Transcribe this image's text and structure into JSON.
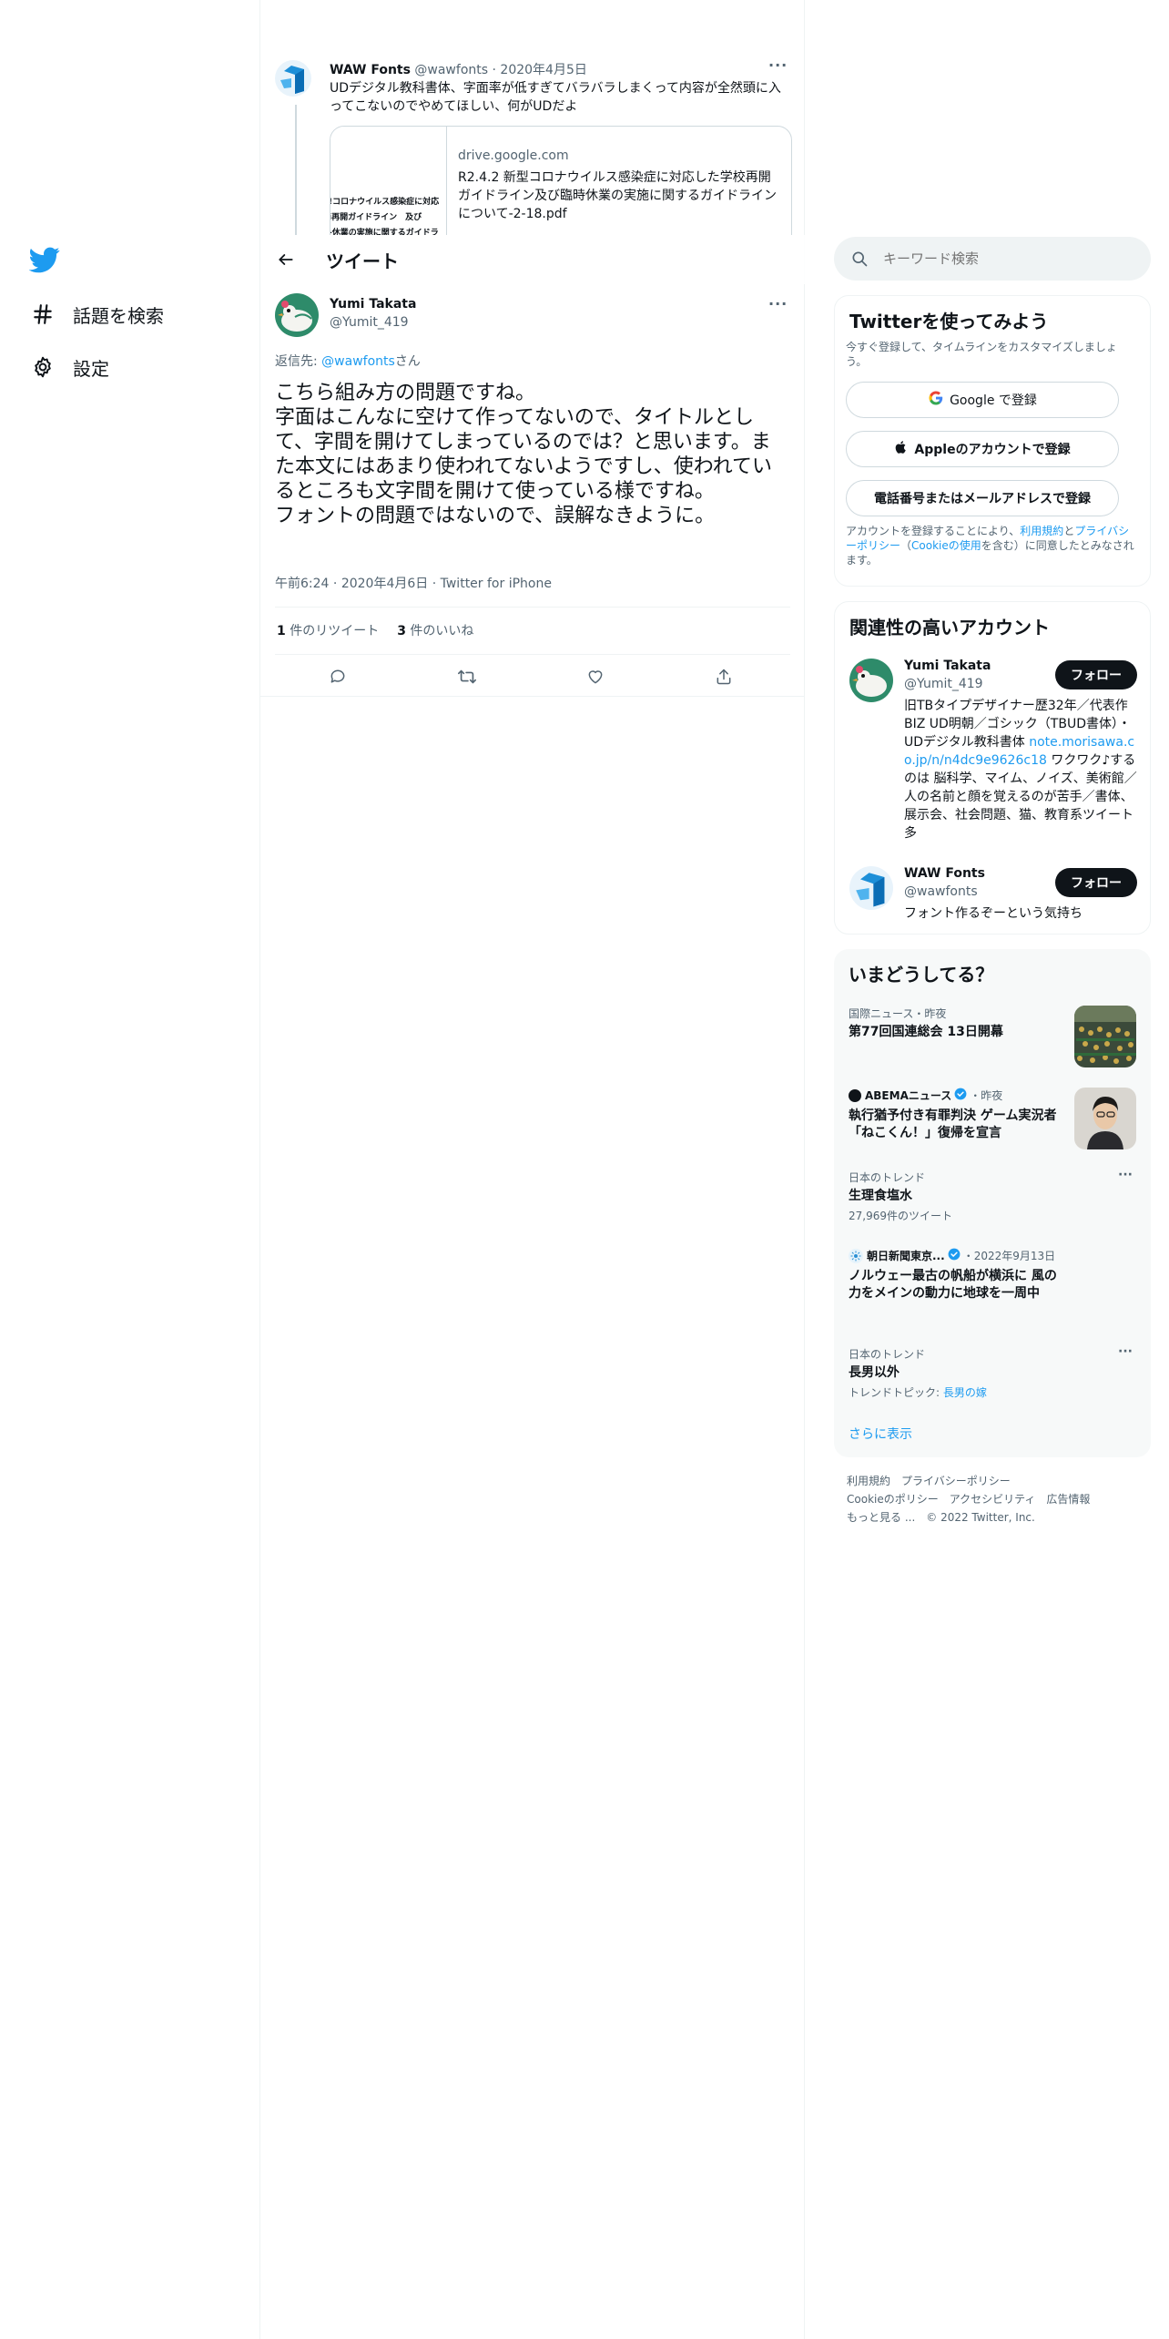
{
  "nav": {
    "explore_label": "話題を検索",
    "settings_label": "設定"
  },
  "prev_tweet": {
    "name": "WAW Fonts",
    "handle": "@wawfonts",
    "date": "2020年4月5日",
    "text": "UDデジタル教科書体、字面率が低すぎてバラバラしまくって内容が全然頭に入ってこないのでやめてほしい、何がUDだよ",
    "card": {
      "thumb_lines": [
        "!コロナウイルス感染症に対応",
        "i再開ガイドライン　及び",
        "-休業の実施に関するガイドラ"
      ],
      "domain": "drive.google.com",
      "title": "R2.4.2 新型コロナウイルス感染症に対応した学校再開ガイドライン及び臨時休業の実施に関するガイドラインについて-2-18.pdf"
    }
  },
  "header": {
    "title": "ツイート"
  },
  "tweet": {
    "name": "Yumi Takata",
    "handle": "@Yumit_419",
    "reply_prefix": "返信先: ",
    "reply_handle": "@wawfonts",
    "reply_suffix": "さん",
    "lines": [
      "こちら組み方の問題ですね。",
      "字面はこんなに空けて作ってないので、タイトルとして、字間を開けてしまっているのでは？と思います。また本文にはあまり使われてないようですし、使われているところも文字間を開けて使っている様ですね。",
      "フォントの問題ではないので、誤解なきように。"
    ],
    "time": "午前6:24",
    "date": "2020年4月6日",
    "source": "Twitter for iPhone",
    "retweets_count": "1",
    "retweets_label": " 件のリツイート",
    "likes_count": "3",
    "likes_label": " 件のいいね"
  },
  "search": {
    "placeholder": "キーワード検索"
  },
  "signup": {
    "title": "Twitterを使ってみよう",
    "subtitle": "今すぐ登録して、タイムラインをカスタマイズしましょう。",
    "google_label": "Google で登録",
    "apple_label": "Appleのアカウントで登録",
    "phone_label": "電話番号またはメールアドレスで登録",
    "legal_prefix": "アカウントを登録することにより、",
    "legal_terms": "利用規約",
    "legal_and": "と",
    "legal_privacy": "プライバシーポリシー",
    "legal_cookie_open": "（",
    "legal_cookie": "Cookieの使用",
    "legal_suffix": "を含む）に同意したとみなされます。"
  },
  "related": {
    "title": "関連性の高いアカウント",
    "follow_label": "フォロー",
    "accounts": [
      {
        "name": "Yumi Takata",
        "handle": "@Yumit_419",
        "bio_before": "旧TBタイプデザイナー歴32年／代表作 BIZ UD明朝／ゴシック（TBUD書体）・UDデジタル教科書体 ",
        "bio_link": "note.morisawa.co.jp/n/n4dc9e9626c18",
        "bio_after": " ワクワク♪するのは 脳科学、マイム、ノイズ、美術館／人の名前と顔を覚えるのが苦手／書体、展示会、社会問題、猫、教育系ツイート多"
      },
      {
        "name": "WAW Fonts",
        "handle": "@wawfonts",
        "bio": "フォント作るぞーという気持ち"
      }
    ]
  },
  "trends": {
    "title": "いまどうしてる？",
    "items": [
      {
        "context": "国際ニュース・昨夜",
        "title": "第77回国連総会 13日開幕"
      },
      {
        "source": "ABEMAニュース",
        "when": "・昨夜",
        "title": "執行猶予付き有罪判決 ゲーム実況者「ねこくん！」復帰を宣言"
      },
      {
        "context": "日本のトレンド",
        "title": "生理食塩水",
        "sub": "27,969件のツイート"
      },
      {
        "source": "朝日新聞東京...",
        "when": "・2022年9月13日",
        "title": "ノルウェー最古の帆船が横浜に 風の力をメインの動力に地球を一周中"
      },
      {
        "context": "日本のトレンド",
        "title": "長男以外",
        "sub_prefix": "トレンドトピック: ",
        "sub_link": "長男の嫁"
      }
    ],
    "show_more": "さらに表示"
  },
  "footer": {
    "links": [
      "利用規約",
      "プライバシーポリシー",
      "Cookieのポリシー",
      "アクセシビリティ",
      "広告情報",
      "もっと見る ..."
    ],
    "copyright": "© 2022 Twitter, Inc."
  },
  "colors": {
    "accent": "#1d9bf0",
    "text": "#0f1419",
    "secondary": "#536471",
    "border": "#eff3f4"
  }
}
